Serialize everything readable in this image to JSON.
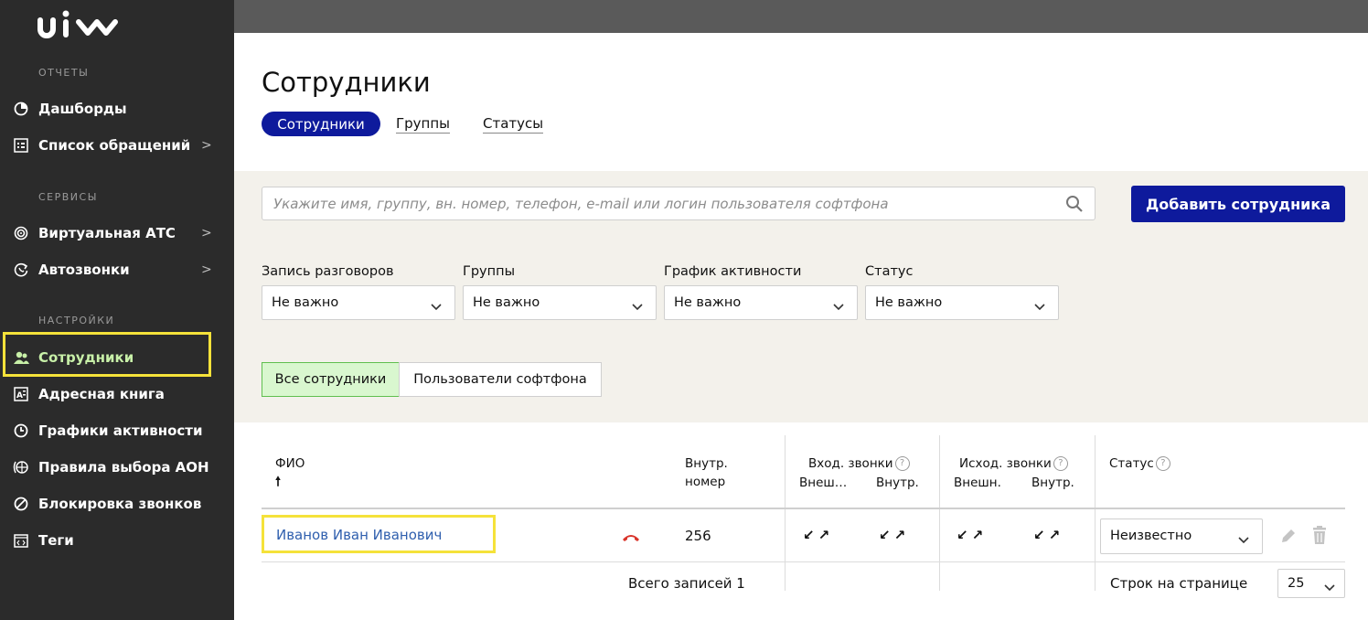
{
  "app": {
    "logo_text": "uiv"
  },
  "sidebar": {
    "sections": [
      {
        "title": "ОТЧЕТЫ"
      },
      {
        "title": "СЕРВИСЫ"
      },
      {
        "title": "НАСТРОЙКИ"
      }
    ],
    "items": [
      {
        "label": "Дашборды",
        "icon": "pie-chart-icon"
      },
      {
        "label": "Список обращений",
        "icon": "list-icon",
        "chevron": ">"
      },
      {
        "label": "Виртуальная АТС",
        "icon": "pbx-icon",
        "chevron": ">"
      },
      {
        "label": "Автозвонки",
        "icon": "autocall-icon",
        "chevron": ">"
      },
      {
        "label": "Сотрудники",
        "icon": "users-icon"
      },
      {
        "label": "Адресная книга",
        "icon": "address-book-icon"
      },
      {
        "label": "Графики активности",
        "icon": "clock-icon"
      },
      {
        "label": "Правила выбора АОН",
        "icon": "caller-id-icon"
      },
      {
        "label": "Блокировка звонков",
        "icon": "block-icon"
      },
      {
        "label": "Теги",
        "icon": "tag-icon"
      }
    ]
  },
  "main": {
    "title": "Сотрудники",
    "tabs": [
      {
        "label": "Сотрудники",
        "active": true
      },
      {
        "label": "Группы"
      },
      {
        "label": "Статусы"
      }
    ],
    "search": {
      "placeholder": "Укажите имя, группу, вн. номер, телефон, e-mail или логин пользователя софтфона"
    },
    "add_button": "Добавить сотрудника",
    "filters": [
      {
        "label": "Запись разговоров",
        "value": "Не важно"
      },
      {
        "label": "Группы",
        "value": "Не важно"
      },
      {
        "label": "График активности",
        "value": "Не важно"
      },
      {
        "label": "Статус",
        "value": "Не важно"
      }
    ],
    "segments": [
      {
        "label": "Все сотрудники",
        "active": true
      },
      {
        "label": "Пользователи софтфона"
      }
    ],
    "table": {
      "headers": {
        "fio": "ФИО",
        "sort_arrow": "🠕",
        "ext_1": "Внутр.",
        "ext_2": "номер",
        "in_calls": "Вход. звонки",
        "in_ext": "Внеш…",
        "in_int": "Внутр.",
        "out_calls": "Исход. звонки",
        "out_ext": "Внешн.",
        "out_int": "Внутр.",
        "status": "Статус",
        "help": "?"
      },
      "rows": [
        {
          "name": "Иванов Иван Иванович",
          "ext": "256",
          "arrows": "↙↗",
          "status": "Неизвестно"
        }
      ]
    },
    "footer": {
      "total": "Всего записей 1",
      "rows_label": "Строк на странице",
      "rows_value": "25"
    },
    "colors": {
      "accent": "#0e1a9c",
      "highlight": "#f5e23a",
      "active_nav": "#c8f0a8"
    }
  }
}
